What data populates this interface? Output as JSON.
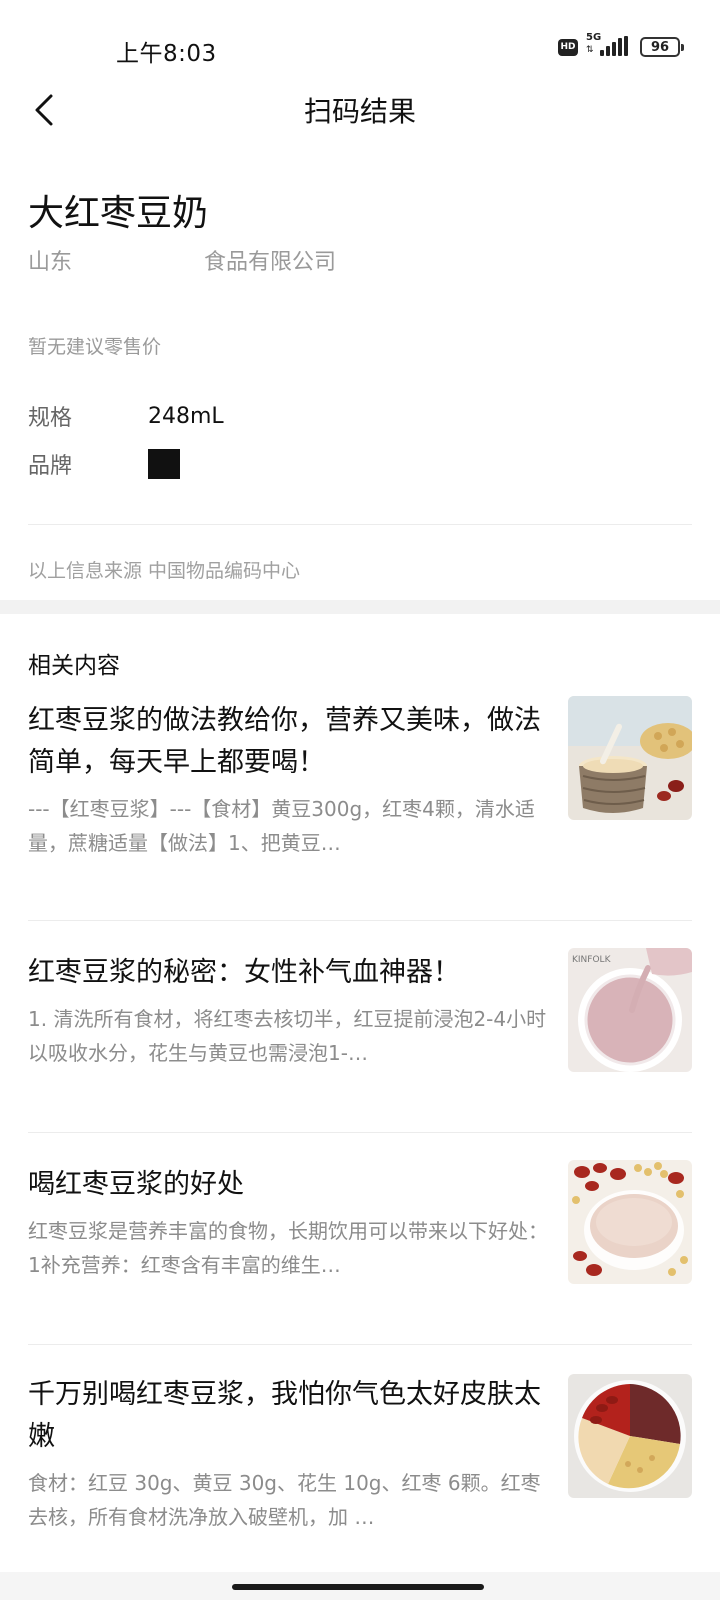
{
  "status_bar": {
    "time": "上午8:03",
    "hd": "HD",
    "network": "5G",
    "battery": "96"
  },
  "nav": {
    "title": "扫码结果"
  },
  "product": {
    "name": "大红枣豆奶",
    "company": "山东　　　　　　食品有限公司",
    "price_note": "暂无建议零售价",
    "spec_label": "规格",
    "spec_value": "248mL",
    "brand_label": "品牌",
    "source_note": "以上信息来源 中国物品编码中心"
  },
  "related": {
    "title": "相关内容",
    "articles": [
      {
        "title": "红枣豆浆的做法教给你，营养又美味，做法简单，每天早上都要喝！",
        "desc": "---【红枣豆浆】---【食材】黄豆300g，红枣4颗，清水适量，蔗糖适量【做法】1、把黄豆…",
        "thumb": "soy-milk-cup-photo"
      },
      {
        "title": "红枣豆浆的秘密：女性补气血神器！",
        "desc": "1. 清洗所有食材，将红枣去核切半，红豆提前浸泡2-4小时以吸收水分，花生与黄豆也需浸泡1-…",
        "thumb": "pink-soy-milk-bowl-photo"
      },
      {
        "title": "喝红枣豆浆的好处",
        "desc": "红枣豆浆是营养丰富的食物，长期饮用可以带来以下好处：1补充营养：红枣含有丰富的维生…",
        "thumb": "jujube-soybean-bowl-photo"
      },
      {
        "title": "千万别喝红枣豆浆，我怕你气色太好皮肤太嫩",
        "desc": "食材：红豆 30g、黄豆 30g、花生 10g、红枣 6颗。红枣去核，所有食材洗净放入破壁机，加 …",
        "thumb": "ingredients-plate-photo"
      }
    ]
  },
  "colors": {
    "text_primary": "#111111",
    "text_secondary": "#8c8c8c",
    "section_bg": "#f2f2f2"
  }
}
